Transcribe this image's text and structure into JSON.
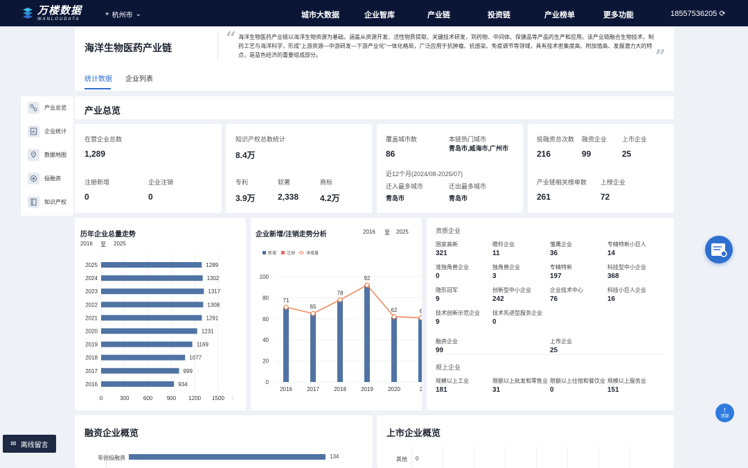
{
  "brand": {
    "name": "万楼数据",
    "subtitle": "WANLOUDATA"
  },
  "city": "杭州市",
  "nav": [
    "城市大数据",
    "企业智库",
    "产业链",
    "投资链",
    "产业榜单",
    "更多功能"
  ],
  "phone": "18557536205",
  "colors": {
    "nav_bg": "#0b1636",
    "accent": "#2f6fd0",
    "bar": "#4f73a3",
    "line": "#ec8553",
    "cancel": "#e06b6b"
  },
  "industry": {
    "name": "海洋生物医药产业链",
    "description": "海洋生物医药产业链以海洋生物资源为基础，涵盖从资源开发、活性物质提取、关键技术研发，到药物、中间体、保健品等产品的生产和应用。该产业链融合生物技术、制药工艺与海洋科学，形成\"上游资源—中游研发—下游产业化\"一体化格局，广泛应用于抗肿瘤、抗感染、免疫调节等领域，具有技术密集度高、附加值高、发展潜力大的特点，是蓝色经济的重要组成部分。"
  },
  "tabs": [
    "统计数据",
    "企业列表"
  ],
  "sidebar": [
    {
      "label": "产业总览",
      "icon": "network-icon"
    },
    {
      "label": "企业统计",
      "icon": "report-icon"
    },
    {
      "label": "数据地图",
      "icon": "map-icon"
    },
    {
      "label": "投融资",
      "icon": "coin-icon"
    },
    {
      "label": "知识产权",
      "icon": "book-icon"
    }
  ],
  "overview": {
    "title": "产业总览",
    "enterprise": {
      "total_label": "在营企业总数",
      "total": "1,289",
      "new_label": "注册新增",
      "new": "0",
      "cancel_label": "企业注销",
      "cancel": "0"
    },
    "ip": {
      "total_label": "知识产权总数统计",
      "total": "8.4万",
      "patent_label": "专利",
      "patent": "3.9万",
      "software_label": "软著",
      "software": "2,338",
      "trademark_label": "商标",
      "trademark": "4.2万"
    },
    "cities": {
      "covered_label": "覆盖城市数",
      "covered": "86",
      "hot_label": "本链热门城市",
      "hot": "青岛市,威海市,广州市",
      "period": "近12个月(2024/08-2025/07)",
      "in_label": "迁入最多城市",
      "in": "青岛市",
      "out_label": "迁出最多城市",
      "out": "青岛市"
    },
    "finance": {
      "total_label": "投融资总次数",
      "total": "216",
      "fin_label": "融资企业",
      "fin": "99",
      "listed_label": "上市企业",
      "listed": "25",
      "ranking_label": "产业链相关榜单数",
      "ranking": "261",
      "onlist_label": "上榜企业",
      "onlist": "72"
    }
  },
  "chart_total": {
    "title": "历年企业总量走势",
    "from": "2016",
    "to": "2025",
    "sep": "至"
  },
  "chart_trend": {
    "title": "企业新增/注销走势分析",
    "from": "2016",
    "to": "2025",
    "sep": "至",
    "legend": [
      "新增",
      "注销",
      "净增量"
    ]
  },
  "quals": {
    "title": "资质企业",
    "items": [
      {
        "label": "国家高新",
        "value": "321"
      },
      {
        "label": "瞪羚企业",
        "value": "11"
      },
      {
        "label": "雏鹰企业",
        "value": "36"
      },
      {
        "label": "专精特新小巨人",
        "value": "14"
      },
      {
        "label": "准独角兽企业",
        "value": "0"
      },
      {
        "label": "独角兽企业",
        "value": "3"
      },
      {
        "label": "专精特新",
        "value": "197"
      },
      {
        "label": "科技型中小企业",
        "value": "368"
      },
      {
        "label": "隐形冠军",
        "value": "9"
      },
      {
        "label": "创新型中小企业",
        "value": "242"
      },
      {
        "label": "企业技术中心",
        "value": "76"
      },
      {
        "label": "科技小巨人企业",
        "value": "16"
      },
      {
        "label": "技术创新示范企业",
        "value": "9"
      },
      {
        "label": "技术先进型服务企业",
        "value": "0"
      }
    ],
    "fin_label": "融资企业",
    "fin": "99",
    "listed_label": "上市企业",
    "listed": "25",
    "scale_title": "规上企业",
    "scale": [
      {
        "label": "规模以上工业",
        "value": "181"
      },
      {
        "label": "限额以上批发和零售业",
        "value": "31"
      },
      {
        "label": "限额以上住宿和餐饮业",
        "value": "0"
      },
      {
        "label": "规模以上服务业",
        "value": "151"
      }
    ]
  },
  "financing_overview": {
    "title": "融资企业概览",
    "bar_label": "非创投融资",
    "bar_value": "134"
  },
  "listed_overview": {
    "title": "上市企业概览",
    "bar_label": "其他",
    "bar_value": "0"
  },
  "top_button": "顶部",
  "message_button": "离线留言",
  "chart_data": [
    {
      "type": "bar",
      "orientation": "horizontal",
      "title": "历年企业总量走势",
      "categories": [
        "2025",
        "2024",
        "2023",
        "2022",
        "2021",
        "2020",
        "2019",
        "2018",
        "2017",
        "2016"
      ],
      "values": [
        1289,
        1302,
        1317,
        1308,
        1291,
        1231,
        1169,
        1077,
        999,
        934
      ],
      "xlim": [
        0,
        1500
      ],
      "xticks": [
        0,
        300,
        600,
        900,
        1200,
        1500
      ]
    },
    {
      "type": "bar",
      "title": "企业新增/注销走势分析",
      "categories": [
        "2016",
        "2017",
        "2018",
        "2019",
        "2020",
        "2"
      ],
      "series": [
        {
          "name": "新增",
          "type": "bar",
          "values": [
            71,
            65,
            78,
            92,
            62,
            61
          ]
        },
        {
          "name": "注销",
          "type": "bar",
          "values": [
            0,
            0,
            0,
            0,
            0,
            0
          ]
        },
        {
          "name": "净增量",
          "type": "line",
          "values": [
            71,
            65,
            78,
            92,
            62,
            61
          ]
        }
      ],
      "data_labels": [
        "71",
        "65",
        "78",
        "92",
        "62",
        "6"
      ],
      "ylim": [
        0,
        100
      ],
      "yticks": [
        0,
        20,
        40,
        60,
        80,
        100
      ]
    }
  ]
}
